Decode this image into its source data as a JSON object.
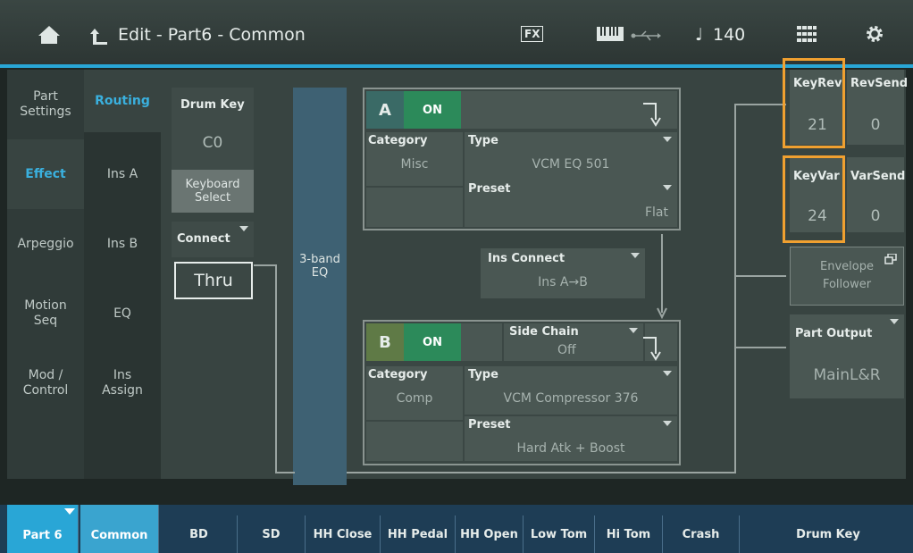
{
  "header": {
    "title": "Edit - Part6 - Common",
    "fx_badge": "FX",
    "tempo_symbol": "♩",
    "tempo": "140",
    "home_icon": "home-icon",
    "back_icon": "back-arrow-icon",
    "keyboard_icon": "keyboard-icon",
    "usb_icon": "usb-icon",
    "grid_icon": "grid-icon",
    "settings_icon": "gear-icon"
  },
  "left_tabs": [
    {
      "label": "Part Settings"
    },
    {
      "label": "Effect",
      "active": true
    },
    {
      "label": "Arpeggio"
    },
    {
      "label": "Motion Seq"
    },
    {
      "label": "Mod / Control"
    }
  ],
  "sub_tabs": [
    {
      "label": "Routing",
      "active": true
    },
    {
      "label": "Ins A"
    },
    {
      "label": "Ins B"
    },
    {
      "label": "EQ"
    },
    {
      "label": "Ins Assign"
    }
  ],
  "drum_key": {
    "label": "Drum Key",
    "value": "C0",
    "keyboard_select": "Keyboard Select"
  },
  "connect": {
    "label": "Connect",
    "value": "Thru"
  },
  "eq_block": {
    "label": "3-band EQ"
  },
  "ins_a": {
    "letter": "A",
    "on": "ON",
    "category_label": "Category",
    "category": "Misc",
    "type_label": "Type",
    "type": "VCM EQ 501",
    "preset_label": "Preset",
    "preset": "Flat"
  },
  "ins_connect": {
    "label": "Ins Connect",
    "value": "Ins A→B"
  },
  "ins_b": {
    "letter": "B",
    "on": "ON",
    "side_chain_label": "Side Chain",
    "side_chain": "Off",
    "category_label": "Category",
    "category": "Comp",
    "type_label": "Type",
    "type": "VCM Compressor 376",
    "preset_label": "Preset",
    "preset": "Hard Atk + Boost"
  },
  "sends": {
    "keyrev_label": "KeyRev",
    "keyrev": "21",
    "revsend_label": "RevSend",
    "revsend": "0",
    "keyvar_label": "KeyVar",
    "keyvar": "24",
    "varsend_label": "VarSend",
    "varsend": "0"
  },
  "envelope_follower": {
    "label": "Envelope Follower"
  },
  "part_output": {
    "label": "Part Output",
    "value": "MainL&R"
  },
  "bottom_tabs": [
    "Part 6",
    "Common",
    "BD",
    "SD",
    "HH Close",
    "HH Pedal",
    "HH Open",
    "Low Tom",
    "Hi Tom",
    "Crash",
    "Drum Key"
  ],
  "colors": {
    "accent": "#29a6d6",
    "on_green": "#2c8a5a",
    "highlight": "#f0a030"
  }
}
